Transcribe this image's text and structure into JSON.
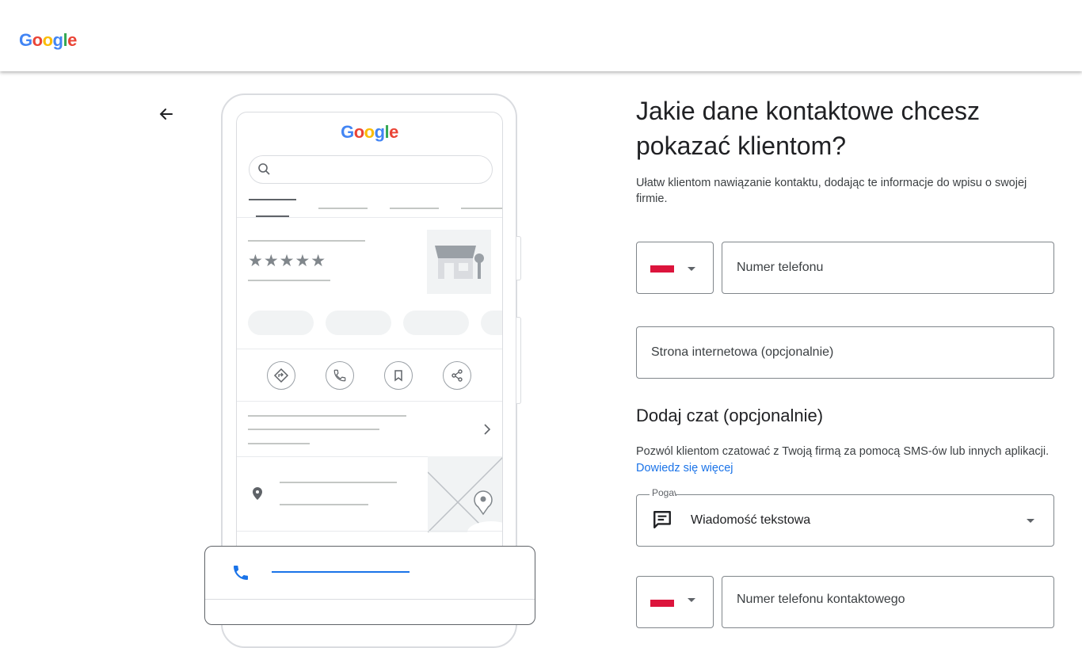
{
  "brand": {
    "logo_letters": [
      "G",
      "o",
      "o",
      "g",
      "l",
      "e"
    ]
  },
  "nav": {
    "back_icon": "arrow-left-icon"
  },
  "illustration": {
    "logo_letters": [
      "G",
      "o",
      "o",
      "g",
      "l",
      "e"
    ],
    "stars": "★★★★★",
    "icons": [
      "directions-icon",
      "phone-icon",
      "bookmark-icon",
      "share-icon",
      "chevron-right-icon",
      "location-pin-icon",
      "phone-icon"
    ]
  },
  "form": {
    "title": "Jakie dane kontaktowe chcesz pokazać klientom?",
    "description": "Ułatw klientom nawiązanie kontaktu, dodając te informacje do wpisu o swojej firmie.",
    "phone_placeholder": "Numer telefonu",
    "website_placeholder": "Strona internetowa (opcjonalnie)",
    "chat_heading": "Dodaj czat (opcjonalnie)",
    "chat_description": "Pozwól klientom czatować z Twoją firmą za pomocą SMS-ów lub innych aplikacji.",
    "chat_link": "Dowiedz się więcej",
    "chat_select_label": "Pogawędka",
    "chat_select_value": "Wiadomość tekstowa",
    "contact_phone_placeholder": "Numer telefonu kontaktowego"
  },
  "colors": {
    "accent": "#1a73e8",
    "flag_red": "#dc143c"
  }
}
